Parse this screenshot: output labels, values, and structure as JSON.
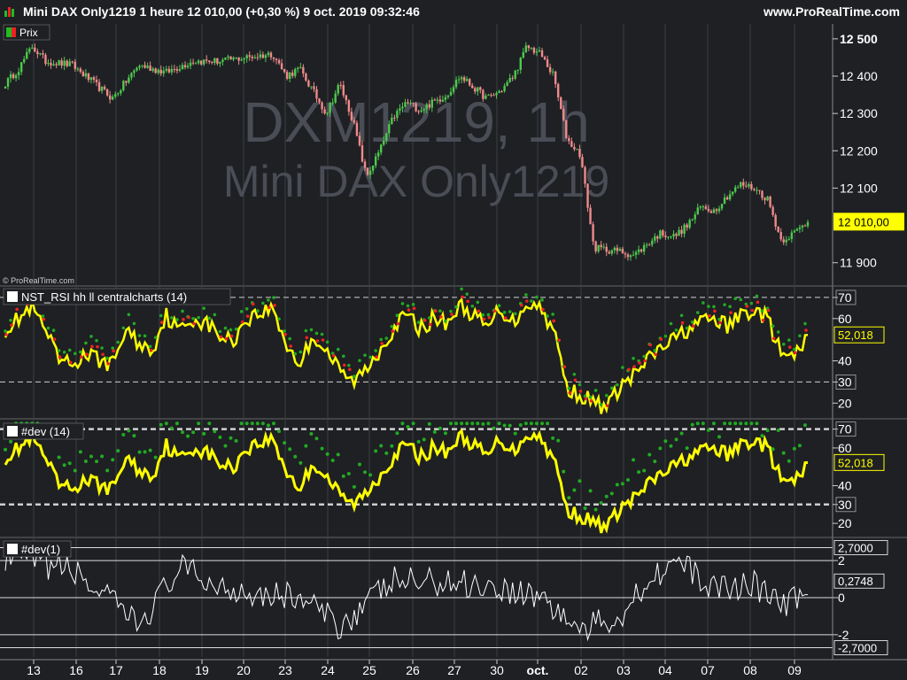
{
  "header": {
    "title": "Mini DAX Only1219 1 heure 12 010,00 (+0,30 %) 9 oct. 2019 09:32:46",
    "site": "www.ProRealTime.com",
    "icon": "prorealtime-logo-icon"
  },
  "colors": {
    "background": "#1e2024",
    "grid": "#3b3e45",
    "up_candle": "#4ec94e",
    "down_candle": "#f08a8a",
    "rsi_line": "#ffff00",
    "dots_green": "#22aa22",
    "dots_red": "#ee2222",
    "dev_line": "#ffffff"
  },
  "watermark": {
    "line1": "DXM1219, 1h",
    "line2": "Mini DAX Only1219"
  },
  "copyright": "© ProRealTime.com",
  "panels": {
    "price": {
      "legend": "Prix"
    },
    "rsi": {
      "legend": "NST_RSI hh ll centralcharts (14)"
    },
    "dev14": {
      "legend": "#dev (14)"
    },
    "dev1": {
      "legend": "#dev(1)"
    }
  },
  "x_axis": {
    "labels": [
      "13",
      "16",
      "17",
      "18",
      "19",
      "20",
      "23",
      "24",
      "25",
      "26",
      "27",
      "30",
      "oct.",
      "02",
      "03",
      "04",
      "07",
      "08",
      "09"
    ]
  },
  "chart_data": [
    {
      "type": "candlestick",
      "title": "Mini DAX Only1219 1 heure",
      "instrument": "DXM1219",
      "timeframe": "1h",
      "last": "12 010,00",
      "ylim": [
        11840,
        12540
      ],
      "y_ticks": [
        "12 500",
        "12 400",
        "12 300",
        "12 200",
        "12 100",
        "11 900"
      ],
      "last_label": "12 010,00",
      "anchors": [
        [
          0,
          12380
        ],
        [
          1,
          12420
        ],
        [
          2,
          12480
        ],
        [
          3,
          12440
        ],
        [
          5,
          12430
        ],
        [
          6,
          12400
        ],
        [
          8,
          12340
        ],
        [
          10,
          12430
        ],
        [
          12,
          12410
        ],
        [
          14,
          12440
        ],
        [
          16,
          12440
        ],
        [
          18,
          12450
        ],
        [
          20,
          12460
        ],
        [
          21,
          12400
        ],
        [
          22,
          12420
        ],
        [
          24,
          12300
        ],
        [
          25,
          12380
        ],
        [
          26,
          12280
        ],
        [
          27,
          12130
        ],
        [
          28,
          12200
        ],
        [
          29,
          12290
        ],
        [
          30,
          12330
        ],
        [
          31,
          12310
        ],
        [
          32,
          12330
        ],
        [
          33,
          12350
        ],
        [
          34,
          12400
        ],
        [
          35,
          12370
        ],
        [
          36,
          12340
        ],
        [
          37,
          12360
        ],
        [
          38,
          12400
        ],
        [
          39,
          12480
        ],
        [
          40,
          12460
        ],
        [
          41,
          12400
        ],
        [
          42,
          12230
        ],
        [
          43,
          12190
        ],
        [
          44,
          11940
        ],
        [
          46,
          11930
        ],
        [
          47,
          11920
        ],
        [
          48,
          11950
        ],
        [
          49,
          11980
        ],
        [
          50,
          11970
        ],
        [
          51,
          12000
        ],
        [
          52,
          12050
        ],
        [
          53,
          12040
        ],
        [
          54,
          12080
        ],
        [
          55,
          12110
        ],
        [
          56,
          12100
        ],
        [
          57,
          12070
        ],
        [
          58,
          11960
        ],
        [
          59,
          11980
        ],
        [
          60,
          12010
        ]
      ]
    },
    {
      "type": "line",
      "title": "NST_RSI hh ll centralcharts (14)",
      "ylim": [
        13,
        75
      ],
      "y_ticks": [
        "70",
        "60",
        "40",
        "30",
        "20"
      ],
      "levels": [
        70,
        30
      ],
      "last_label": "52,018",
      "anchors": [
        [
          0,
          55
        ],
        [
          1,
          60
        ],
        [
          2,
          65
        ],
        [
          3,
          54
        ],
        [
          4,
          40
        ],
        [
          5,
          38
        ],
        [
          6,
          43
        ],
        [
          8,
          38
        ],
        [
          9,
          55
        ],
        [
          10,
          48
        ],
        [
          11,
          45
        ],
        [
          12,
          62
        ],
        [
          13,
          54
        ],
        [
          14,
          60
        ],
        [
          15,
          58
        ],
        [
          16,
          52
        ],
        [
          17,
          49
        ],
        [
          18,
          60
        ],
        [
          20,
          65
        ],
        [
          21,
          48
        ],
        [
          22,
          38
        ],
        [
          23,
          52
        ],
        [
          24,
          45
        ],
        [
          25,
          35
        ],
        [
          26,
          30
        ],
        [
          27,
          36
        ],
        [
          29,
          55
        ],
        [
          30,
          62
        ],
        [
          31,
          55
        ],
        [
          32,
          60
        ],
        [
          33,
          58
        ],
        [
          34,
          66
        ],
        [
          35,
          62
        ],
        [
          36,
          55
        ],
        [
          37,
          65
        ],
        [
          38,
          58
        ],
        [
          39,
          68
        ],
        [
          40,
          65
        ],
        [
          41,
          55
        ],
        [
          42,
          27
        ],
        [
          43,
          24
        ],
        [
          44,
          20
        ],
        [
          45,
          18
        ],
        [
          46,
          28
        ],
        [
          47,
          33
        ],
        [
          48,
          40
        ],
        [
          49,
          46
        ],
        [
          50,
          50
        ],
        [
          51,
          55
        ],
        [
          52,
          58
        ],
        [
          53,
          60
        ],
        [
          54,
          56
        ],
        [
          55,
          62
        ],
        [
          56,
          64
        ],
        [
          57,
          60
        ],
        [
          58,
          43
        ],
        [
          59,
          41
        ],
        [
          60,
          52
        ]
      ]
    },
    {
      "type": "line",
      "title": "#dev (14)",
      "ylim": [
        13,
        75
      ],
      "y_ticks": [
        "70",
        "60",
        "40",
        "30",
        "20"
      ],
      "levels": [
        70,
        30
      ],
      "last_label": "52,018",
      "anchors": [
        [
          0,
          55
        ],
        [
          1,
          60
        ],
        [
          2,
          65
        ],
        [
          3,
          54
        ],
        [
          4,
          40
        ],
        [
          5,
          38
        ],
        [
          6,
          43
        ],
        [
          8,
          38
        ],
        [
          9,
          55
        ],
        [
          10,
          48
        ],
        [
          11,
          45
        ],
        [
          12,
          62
        ],
        [
          13,
          54
        ],
        [
          14,
          60
        ],
        [
          15,
          58
        ],
        [
          16,
          52
        ],
        [
          17,
          49
        ],
        [
          18,
          60
        ],
        [
          20,
          65
        ],
        [
          21,
          48
        ],
        [
          22,
          38
        ],
        [
          23,
          52
        ],
        [
          24,
          45
        ],
        [
          25,
          35
        ],
        [
          26,
          30
        ],
        [
          27,
          36
        ],
        [
          29,
          55
        ],
        [
          30,
          62
        ],
        [
          31,
          55
        ],
        [
          32,
          60
        ],
        [
          33,
          58
        ],
        [
          34,
          66
        ],
        [
          35,
          62
        ],
        [
          36,
          55
        ],
        [
          37,
          65
        ],
        [
          38,
          58
        ],
        [
          39,
          68
        ],
        [
          40,
          65
        ],
        [
          41,
          55
        ],
        [
          42,
          27
        ],
        [
          43,
          24
        ],
        [
          44,
          20
        ],
        [
          45,
          18
        ],
        [
          46,
          28
        ],
        [
          47,
          33
        ],
        [
          48,
          40
        ],
        [
          49,
          46
        ],
        [
          50,
          50
        ],
        [
          51,
          55
        ],
        [
          52,
          58
        ],
        [
          53,
          60
        ],
        [
          54,
          56
        ],
        [
          55,
          62
        ],
        [
          56,
          64
        ],
        [
          57,
          60
        ],
        [
          58,
          43
        ],
        [
          59,
          41
        ],
        [
          60,
          52
        ]
      ]
    },
    {
      "type": "line",
      "title": "#dev(1)",
      "ylim": [
        -3.2,
        3.2
      ],
      "y_ticks": [
        "2",
        "0",
        "-2"
      ],
      "levels": [
        2.7,
        2,
        0,
        -2,
        -2.7
      ],
      "level_labels": [
        "2,7000",
        "-2,7000"
      ],
      "last_label": "0,2748"
    }
  ]
}
